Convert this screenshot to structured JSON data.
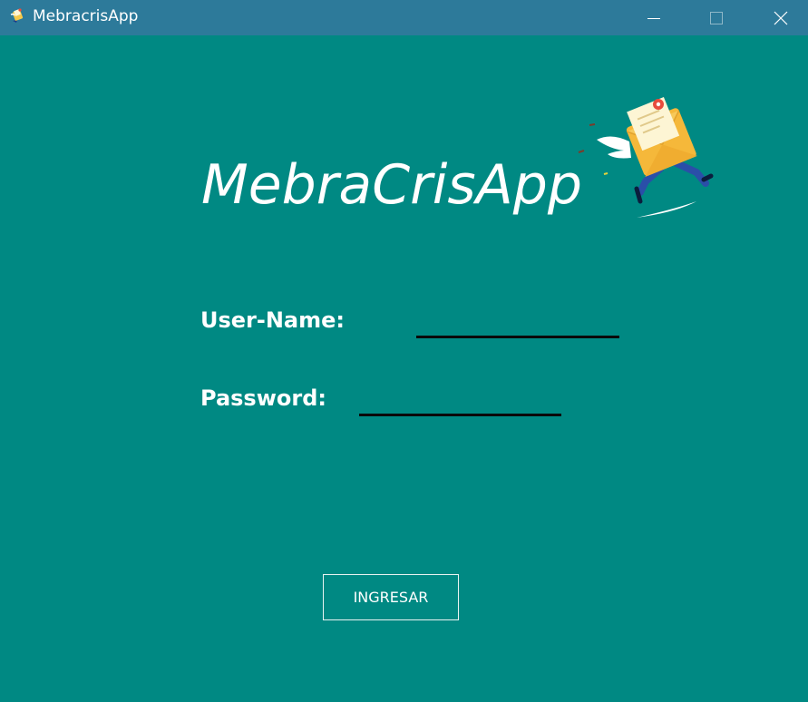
{
  "window": {
    "title": "MebracrisApp",
    "controls": {
      "minimize_icon": "minimize-icon",
      "maximize_icon": "maximize-icon",
      "close_icon": "close-icon"
    }
  },
  "login": {
    "heading": "MebraCrisApp",
    "username_label": "User-Name:",
    "username_value": "",
    "password_label": "Password:",
    "password_value": "",
    "submit_label": "INGRESAR"
  },
  "colors": {
    "background": "#008983",
    "titlebar": "#2d7a9a",
    "text": "#ffffff",
    "input_underline": "#0a0a0a"
  },
  "icons": {
    "app": "flying-letter-icon",
    "mascot": "flying-envelope-mascot"
  }
}
